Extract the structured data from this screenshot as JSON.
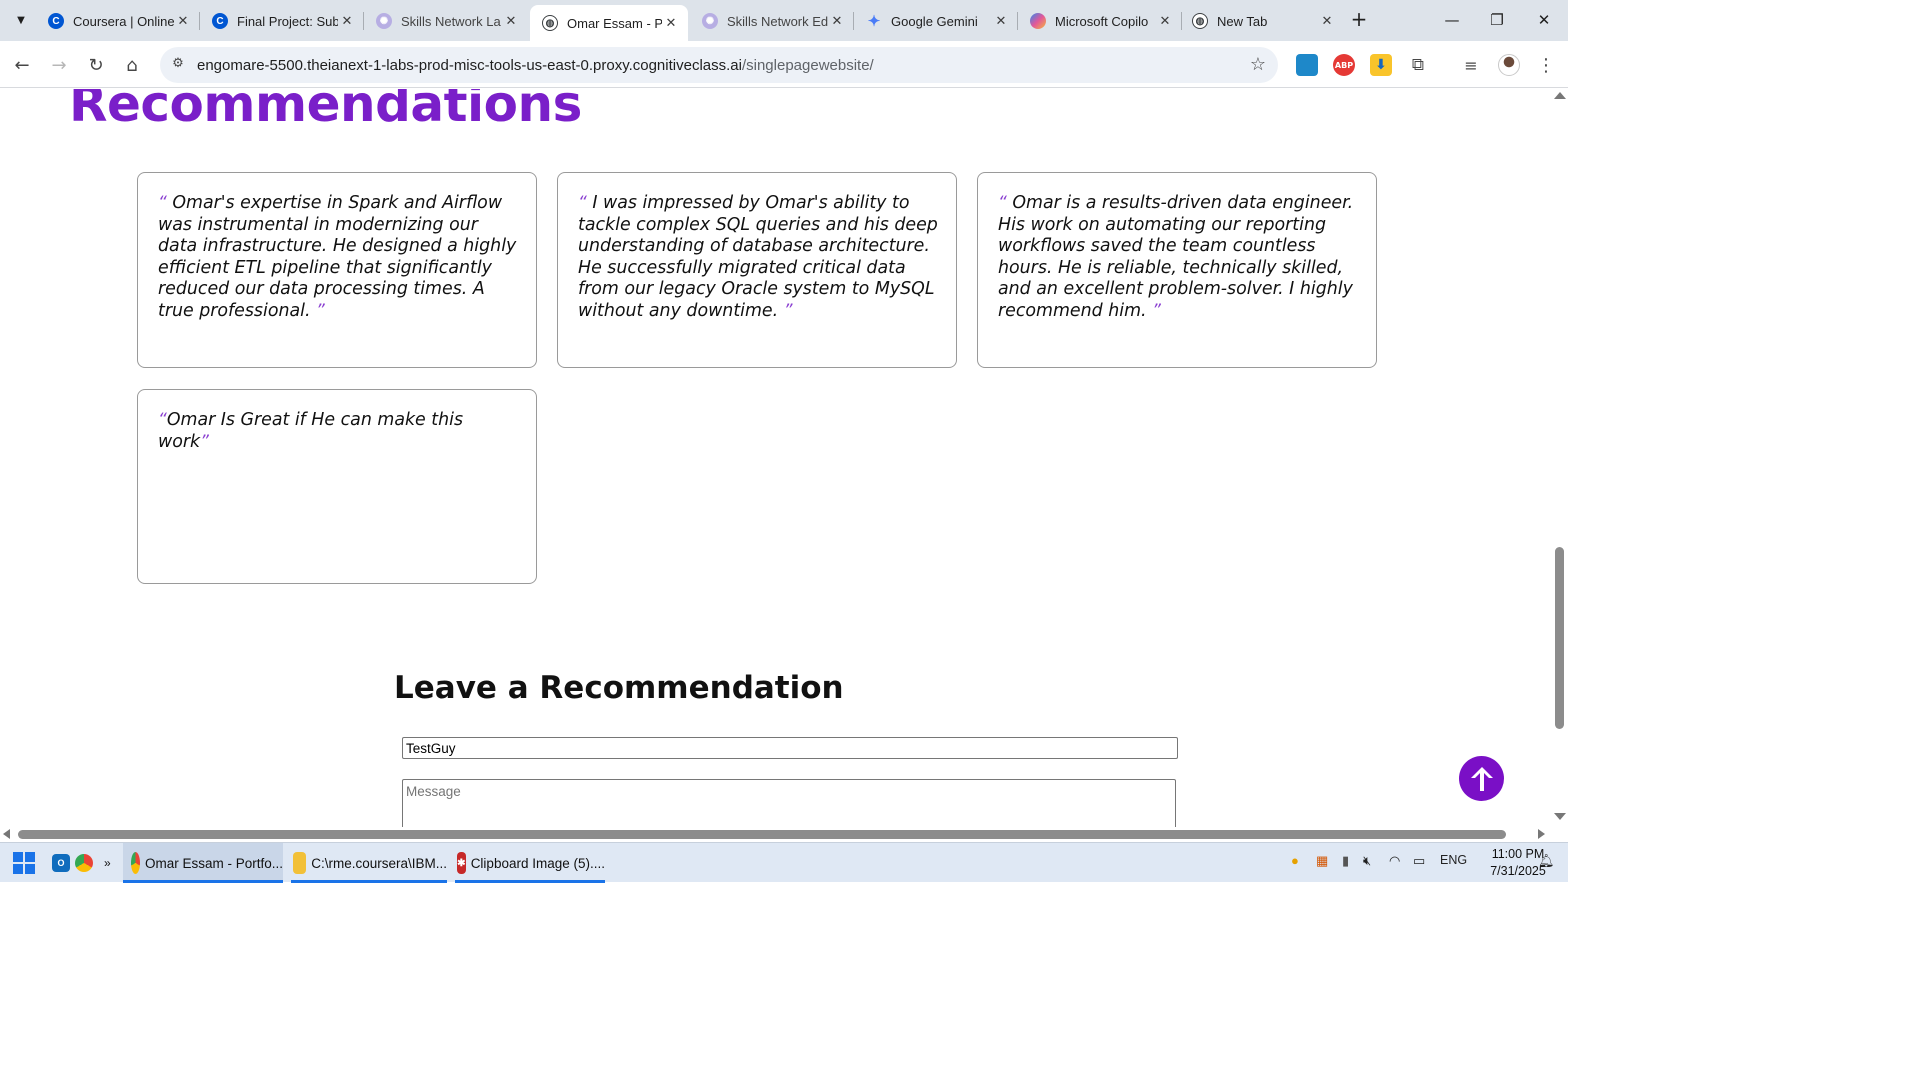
{
  "browser": {
    "tabs": [
      {
        "title": "Coursera | Online",
        "favicon": "coursera-icon",
        "color": "#0056d2"
      },
      {
        "title": "Final Project: Sub",
        "favicon": "coursera-icon",
        "color": "#0056d2"
      },
      {
        "title": "Skills Network La",
        "favicon": "skills-network-icon",
        "color": "#9b8bd6"
      },
      {
        "title": "Omar Essam - Po",
        "favicon": "globe-icon",
        "color": "#3c4043"
      },
      {
        "title": "Skills Network Ed",
        "favicon": "skills-network-icon",
        "color": "#9b8bd6"
      },
      {
        "title": "Google Gemini",
        "favicon": "gemini-icon",
        "color": "#4a7cf7"
      },
      {
        "title": "Microsoft Copilo",
        "favicon": "copilot-icon",
        "color": "#e2579a"
      },
      {
        "title": "New Tab",
        "favicon": "globe-icon",
        "color": "#3c4043"
      }
    ],
    "active_tab": 3,
    "url_host": "engomare-5500.theianext-1-labs-prod-misc-tools-us-east-0.proxy.cognitiveclass.ai",
    "url_path": "/singlepagewebsite/",
    "extensions": [
      {
        "name": "print-extension-icon",
        "color": "#1e88c9",
        "label": ""
      },
      {
        "name": "adblock-plus-icon",
        "color": "#e53935",
        "label": "ABP"
      },
      {
        "name": "download-extension-icon",
        "color": "#1565c0",
        "label": "⬇"
      }
    ]
  },
  "page": {
    "heading": "Recommendations",
    "recommendations": [
      {
        "text": " Omar's expertise in Spark and Airflow was instrumental in modernizing our data infrastructure. He designed a highly efficient ETL pipeline that significantly reduced our data processing times. A true professional. ",
        "open_quote": "“",
        "close_quote": "”"
      },
      {
        "text": " I was impressed by Omar's ability to tackle complex SQL queries and his deep understanding of database architecture. He successfully migrated critical data from our legacy Oracle system to MySQL without any downtime. ",
        "open_quote": "“",
        "close_quote": "”"
      },
      {
        "text": " Omar is a results-driven data engineer. His work on automating our reporting workflows saved the team countless hours. He is reliable, technically skilled, and an excellent problem-solver. I highly recommend him. ",
        "open_quote": "“",
        "close_quote": "”"
      },
      {
        "text": "Omar Is Great if He can make this work",
        "open_quote": "“",
        "close_quote": "”"
      }
    ],
    "form": {
      "heading": "Leave a Recommendation",
      "name_value": "TestGuy",
      "message_placeholder": "Message"
    },
    "accent_color": "#7a1fc9"
  },
  "taskbar": {
    "apps": [
      {
        "label": "Omar Essam - Portfo...",
        "icon": "chrome-icon"
      },
      {
        "label": "C:\\rme.coursera\\IBM...",
        "icon": "file-explorer-icon"
      },
      {
        "label": "Clipboard Image (5)....",
        "icon": "image-viewer-icon"
      }
    ],
    "language": "ENG",
    "time": "11:00 PM",
    "date": "7/31/2025"
  }
}
